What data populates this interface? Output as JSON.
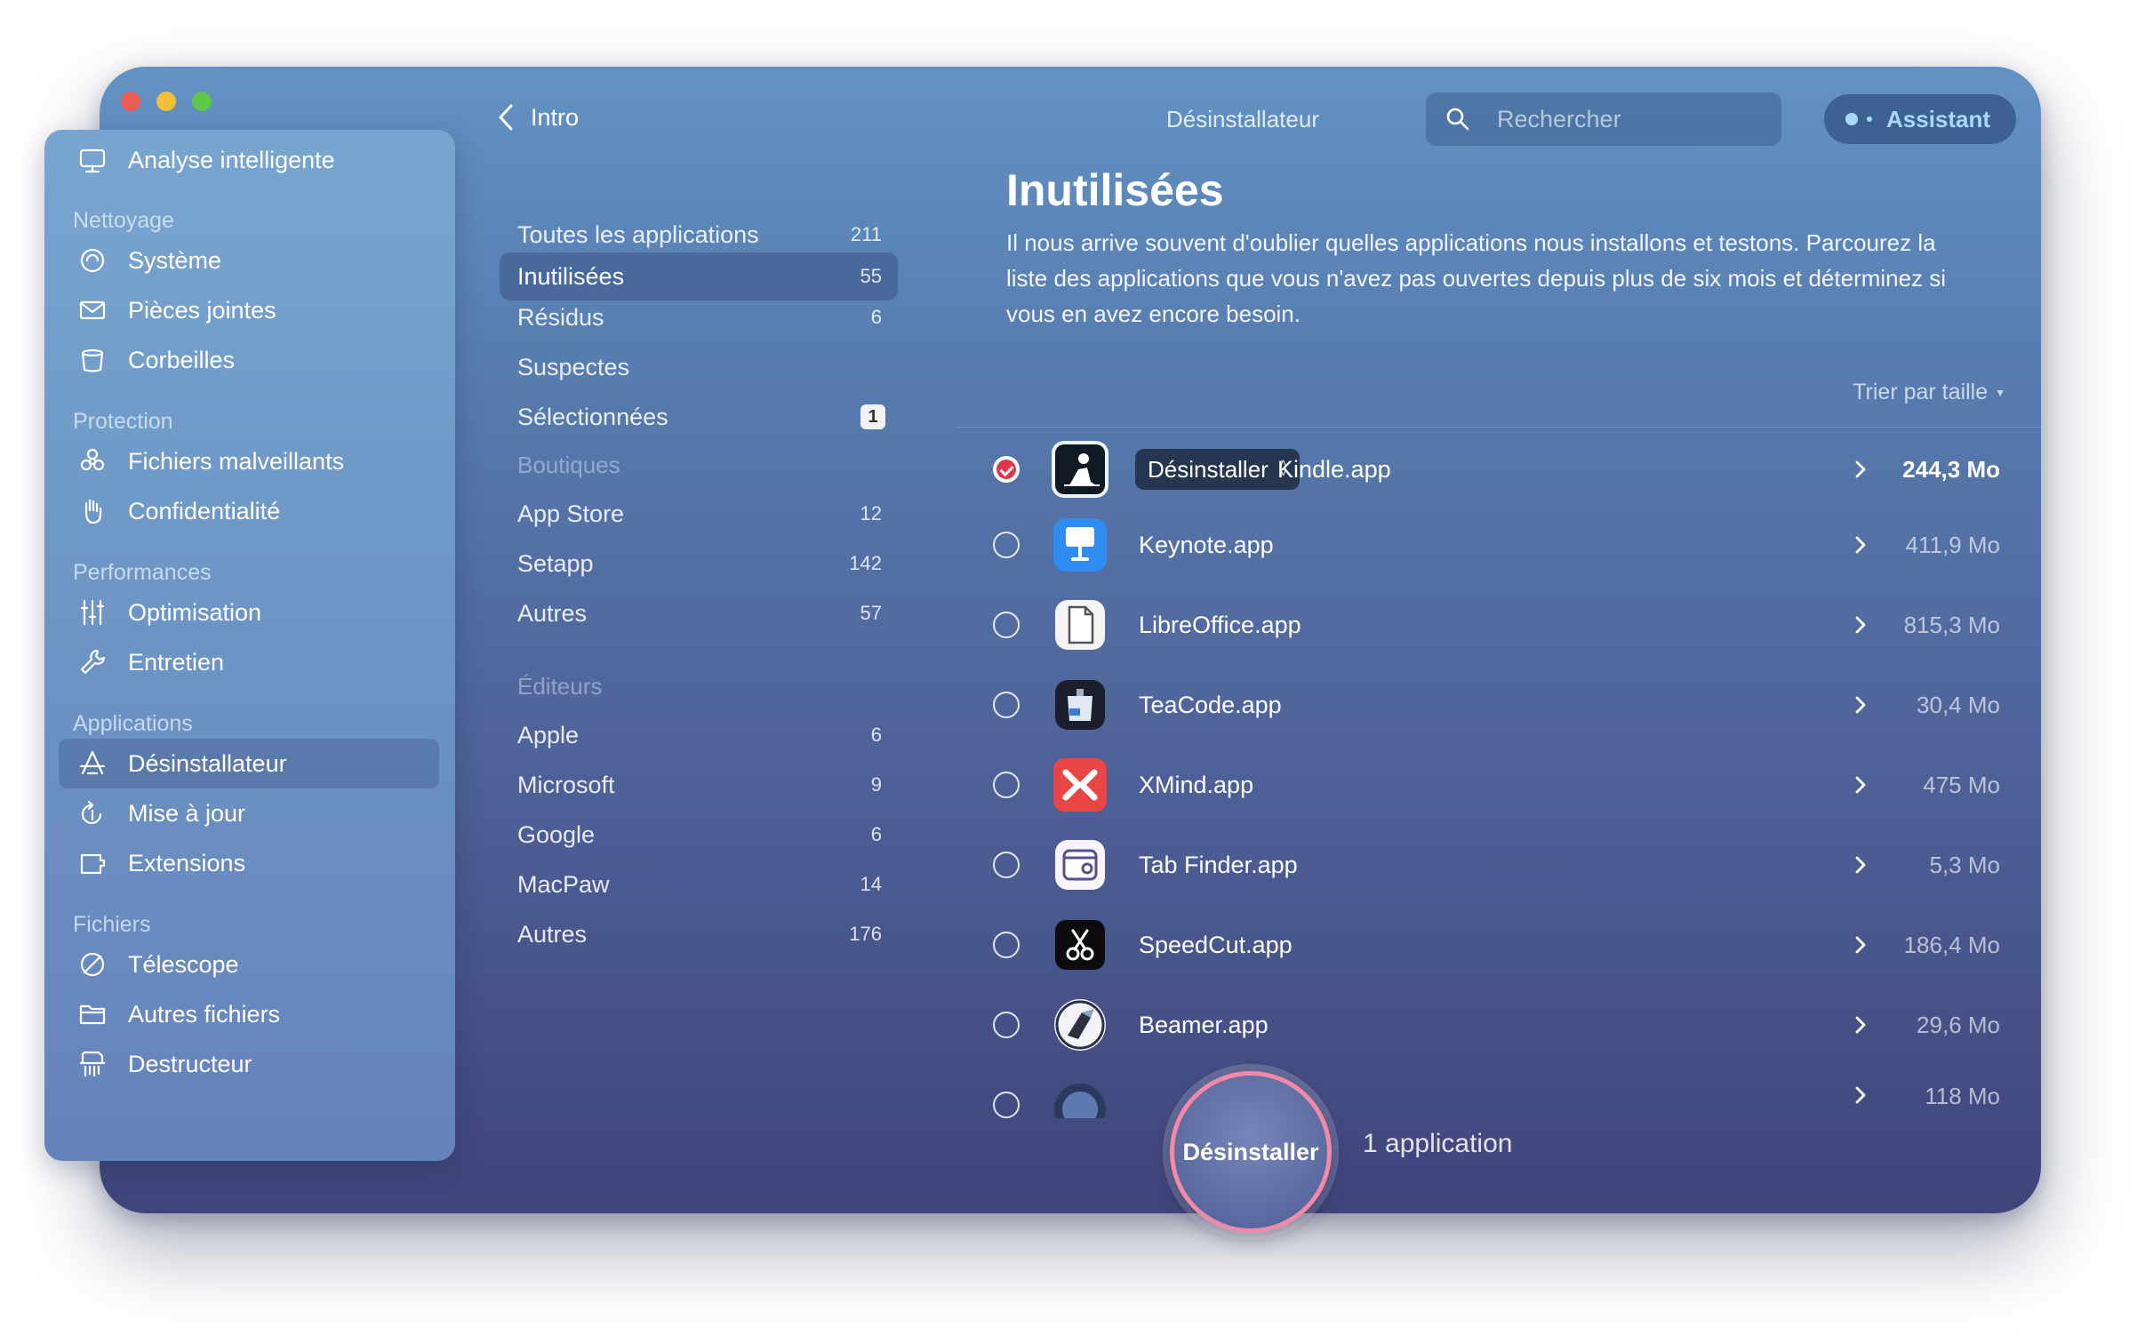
{
  "window": {
    "title": "Désinstallateur"
  },
  "nav": {
    "back_label": "Intro"
  },
  "search": {
    "placeholder": "Rechercher"
  },
  "assistant": {
    "label": "Assistant"
  },
  "sidebar": {
    "top_item": "Analyse intelligente",
    "sections": [
      {
        "title": "Nettoyage",
        "items": [
          "Système",
          "Pièces jointes",
          "Corbeilles"
        ]
      },
      {
        "title": "Protection",
        "items": [
          "Fichiers malveillants",
          "Confidentialité"
        ]
      },
      {
        "title": "Performances",
        "items": [
          "Optimisation",
          "Entretien"
        ]
      },
      {
        "title": "Applications",
        "items": [
          "Désinstallateur",
          "Mise à jour",
          "Extensions"
        ]
      },
      {
        "title": "Fichiers",
        "items": [
          "Télescope",
          "Autres fichiers",
          "Destructeur"
        ]
      }
    ],
    "active_item": "Désinstallateur",
    "icons": [
      "monitor-icon",
      "system-icon",
      "mail-icon",
      "trash-icon",
      "biohazard-icon",
      "hand-icon",
      "sliders-icon",
      "wrench-icon",
      "apps-icon",
      "update-icon",
      "extensions-icon",
      "telescope-icon",
      "folder-icon",
      "shredder-icon"
    ]
  },
  "categories": {
    "main": [
      {
        "label": "Toutes les applications",
        "count": "211"
      },
      {
        "label": "Inutilisées",
        "count": "55"
      },
      {
        "label": "Résidus",
        "count": "6"
      },
      {
        "label": "Suspectes",
        "count": ""
      },
      {
        "label": "Sélectionnées",
        "badge": "1"
      }
    ],
    "stores_heading": "Boutiques",
    "stores": [
      {
        "label": "App Store",
        "count": "12"
      },
      {
        "label": "Setapp",
        "count": "142"
      },
      {
        "label": "Autres",
        "count": "57"
      }
    ],
    "vendors_heading": "Éditeurs",
    "vendors": [
      {
        "label": "Apple",
        "count": "6"
      },
      {
        "label": "Microsoft",
        "count": "9"
      },
      {
        "label": "Google",
        "count": "6"
      },
      {
        "label": "MacPaw",
        "count": "14"
      },
      {
        "label": "Autres",
        "count": "176"
      }
    ],
    "active": "Inutilisées"
  },
  "content": {
    "title": "Inutilisées",
    "description": "Il nous arrive souvent d'oublier quelles applications nous installons et testons. Parcourez la liste des applications que vous n'avez pas ouvertes depuis plus de six mois et déterminez si vous en avez encore besoin.",
    "sort_label": "Trier par taille"
  },
  "apps": [
    {
      "name": "Kindle.app",
      "size": "244,3 Mo",
      "selected": true,
      "action": "Désinstaller",
      "icon": "kindle-icon"
    },
    {
      "name": "Keynote.app",
      "size": "411,9 Mo",
      "selected": false,
      "icon": "keynote-icon"
    },
    {
      "name": "LibreOffice.app",
      "size": "815,3 Mo",
      "selected": false,
      "icon": "libreoffice-icon"
    },
    {
      "name": "TeaCode.app",
      "size": "30,4 Mo",
      "selected": false,
      "icon": "teacode-icon"
    },
    {
      "name": "XMind.app",
      "size": "475 Mo",
      "selected": false,
      "icon": "xmind-icon"
    },
    {
      "name": "Tab Finder.app",
      "size": "5,3 Mo",
      "selected": false,
      "icon": "tabfinder-icon"
    },
    {
      "name": "SpeedCut.app",
      "size": "186,4 Mo",
      "selected": false,
      "icon": "speedcut-icon"
    },
    {
      "name": "Beamer.app",
      "size": "29,6 Mo",
      "selected": false,
      "icon": "beamer-icon"
    },
    {
      "name": "",
      "size": "118 Mo",
      "selected": false,
      "icon": "app-icon"
    }
  ],
  "footer": {
    "button_label": "Désinstaller",
    "count_label": "1 application"
  },
  "colors": {
    "accent_check": "#e0384a",
    "assistant_text": "#a8d7ff",
    "button_ring": "#f08aa8"
  }
}
